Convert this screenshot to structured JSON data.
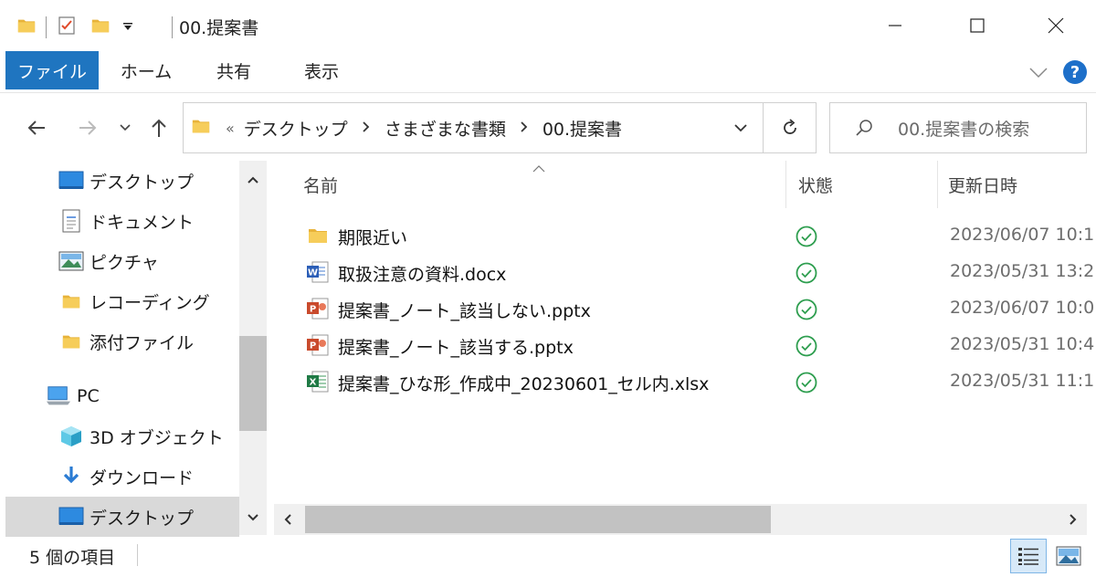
{
  "window": {
    "title": "00.提案書"
  },
  "ribbon": {
    "tabs": [
      "ファイル",
      "ホーム",
      "共有",
      "表示"
    ]
  },
  "address": {
    "overflow": "«",
    "segments": [
      "デスクトップ",
      "さまざまな書類",
      "00.提案書"
    ]
  },
  "search": {
    "placeholder": "00.提案書の検索"
  },
  "sidebar": {
    "items": [
      {
        "label": "デスクトップ",
        "icon": "desktop-icon"
      },
      {
        "label": "ドキュメント",
        "icon": "documents-icon"
      },
      {
        "label": "ピクチャ",
        "icon": "pictures-icon"
      },
      {
        "label": "レコーディング",
        "icon": "folder-icon"
      },
      {
        "label": "添付ファイル",
        "icon": "folder-icon"
      },
      {
        "label": "PC",
        "icon": "pc-icon"
      },
      {
        "label": "3D オブジェクト",
        "icon": "3d-objects-icon"
      },
      {
        "label": "ダウンロード",
        "icon": "download-icon"
      },
      {
        "label": "デスクトップ",
        "icon": "desktop-icon"
      }
    ]
  },
  "columns": {
    "name": "名前",
    "status": "状態",
    "modified": "更新日時"
  },
  "files": [
    {
      "name": "期限近い",
      "type": "folder",
      "date": "2023/06/07 10:1"
    },
    {
      "name": "取扱注意の資料.docx",
      "type": "word",
      "date": "2023/05/31 13:2"
    },
    {
      "name": "提案書_ノート_該当しない.pptx",
      "type": "powerpoint",
      "date": "2023/06/07 10:0"
    },
    {
      "name": "提案書_ノート_該当する.pptx",
      "type": "powerpoint",
      "date": "2023/05/31 10:4"
    },
    {
      "name": "提案書_ひな形_作成中_20230601_セル内.xlsx",
      "type": "excel",
      "date": "2023/05/31 11:1"
    }
  ],
  "status": {
    "item_count": "5 個の項目"
  },
  "colors": {
    "file_tab": "#1f75c0",
    "sync_ok": "#2e9e4f",
    "folder": "#f3c64e"
  }
}
